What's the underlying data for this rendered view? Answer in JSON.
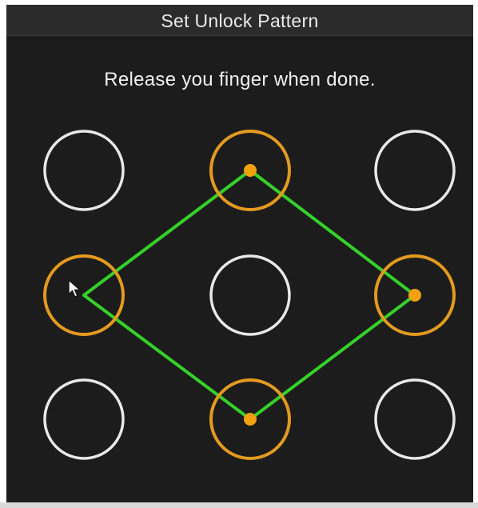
{
  "dialog": {
    "title": "Set Unlock Pattern",
    "instruction": "Release you finger when done."
  },
  "pattern": {
    "grid_rows": 3,
    "grid_cols": 3,
    "selected_nodes": [
      2,
      4,
      6,
      8
    ],
    "path_order": [
      4,
      2,
      6,
      8,
      4
    ],
    "idle_ring_color": "#e8e8e8",
    "active_ring_color": "#e39a1f",
    "line_color": "#35d12a",
    "background_color": "#1c1c1c"
  },
  "icons": {
    "cursor": "arrow-cursor-icon"
  }
}
